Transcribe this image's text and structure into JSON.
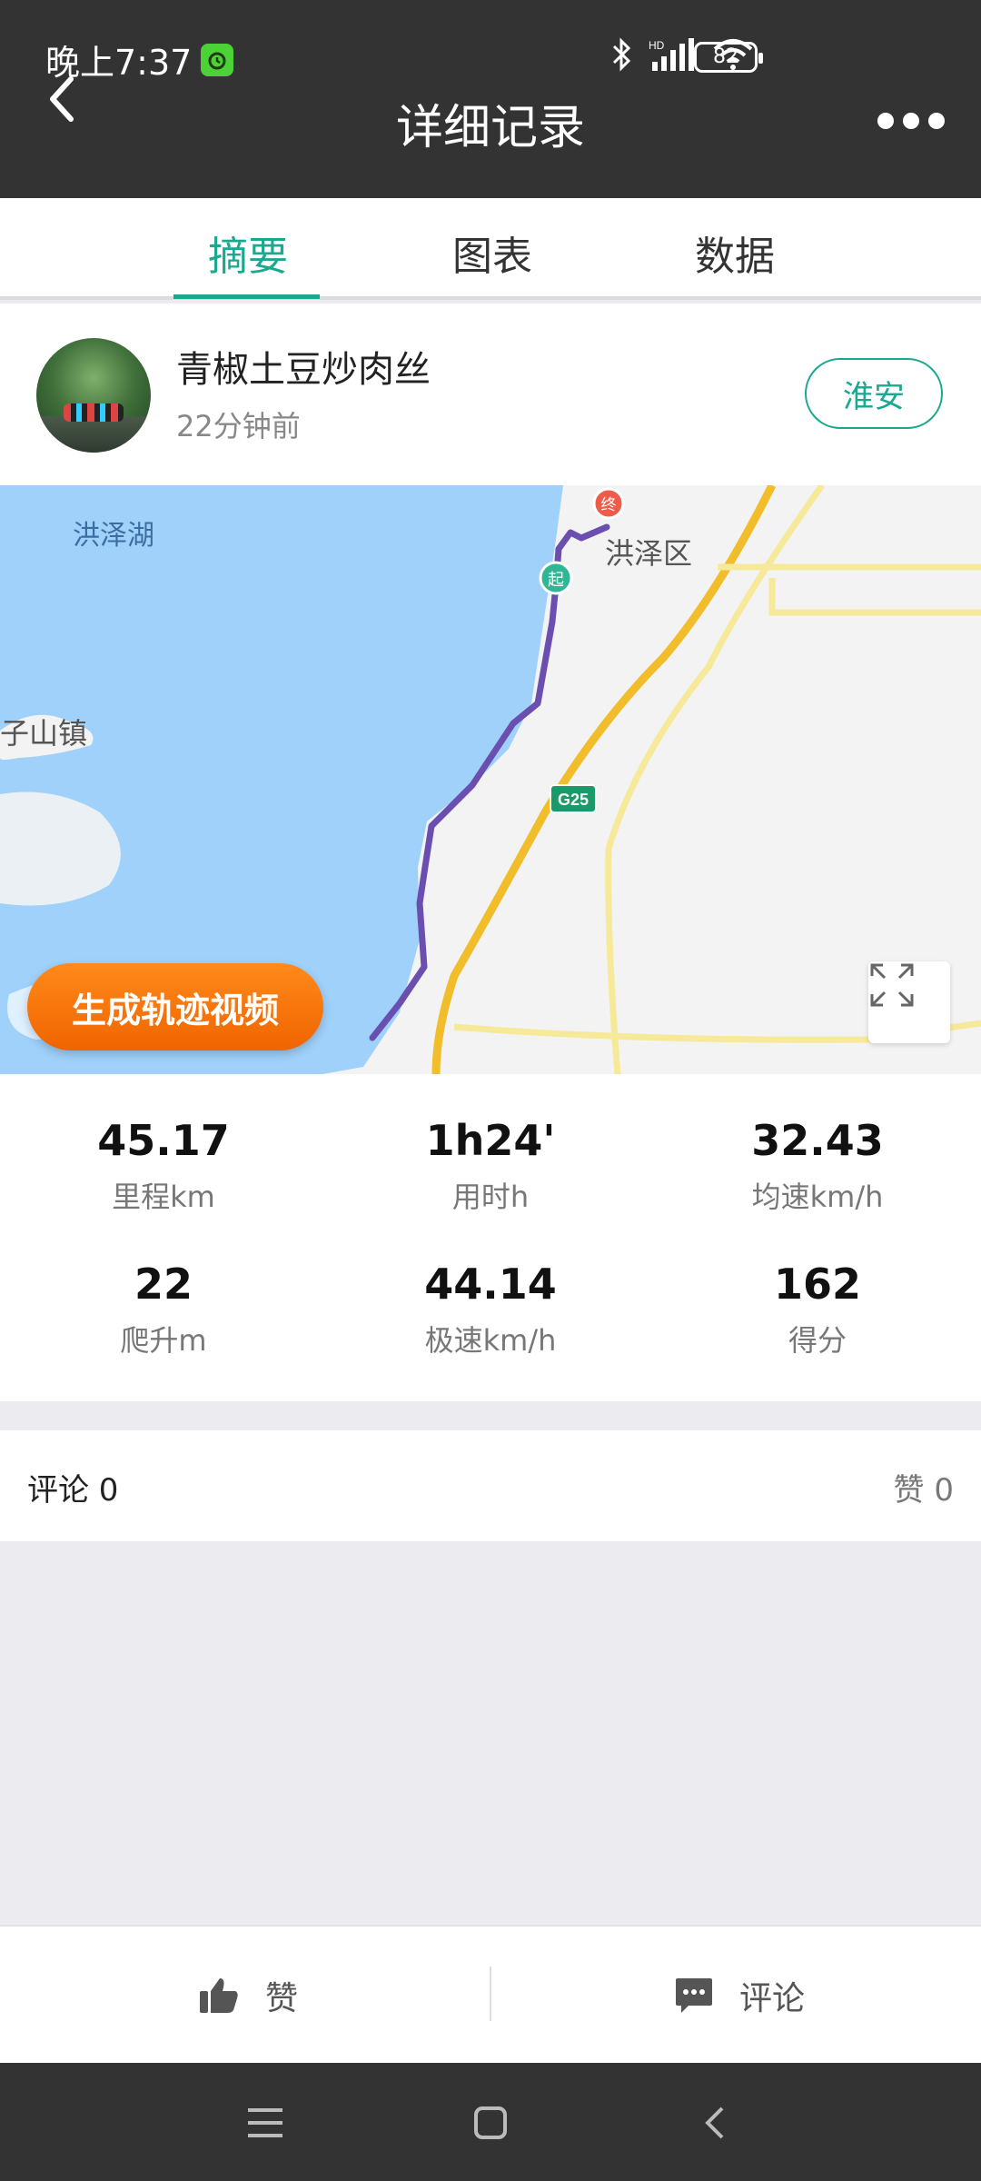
{
  "status_bar": {
    "time": "晚上7:37",
    "battery": "82"
  },
  "header": {
    "title": "详细记录"
  },
  "tabs": [
    {
      "label": "摘要",
      "active": true
    },
    {
      "label": "图表",
      "active": false
    },
    {
      "label": "数据",
      "active": false
    }
  ],
  "user": {
    "name": "青椒土豆炒肉丝",
    "time_ago": "22分钟前",
    "city": "淮安"
  },
  "map": {
    "labels": {
      "lake": "洪泽湖",
      "district": "洪泽区",
      "town": "子山镇",
      "highway": "G25",
      "start": "起",
      "end": "终"
    },
    "generate_video_label": "生成轨迹视频",
    "route_color": "#6a4fb0"
  },
  "stats": [
    {
      "value": "45.17",
      "label": "里程km"
    },
    {
      "value": "1h24'",
      "label": "用时h"
    },
    {
      "value": "32.43",
      "label": "均速km/h"
    },
    {
      "value": "22",
      "label": "爬升m"
    },
    {
      "value": "44.14",
      "label": "极速km/h"
    },
    {
      "value": "162",
      "label": "得分"
    }
  ],
  "social": {
    "comments_label": "评论  0",
    "likes_label": "赞  0"
  },
  "actions": {
    "like_label": "赞",
    "comment_label": "评论"
  },
  "colors": {
    "accent": "#1aa88f",
    "header_bg": "#333333",
    "video_button": "#f57a0a"
  }
}
